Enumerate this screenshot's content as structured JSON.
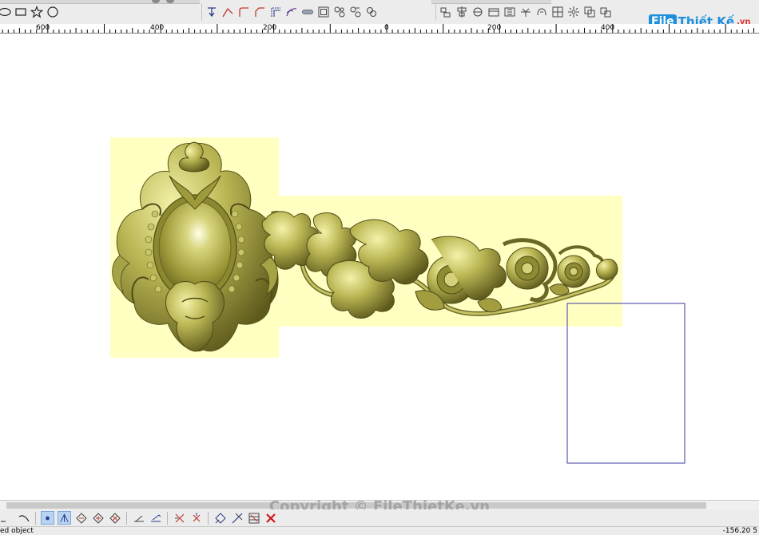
{
  "toolbar_top": {
    "groups": [
      {
        "name": "shapes",
        "icons": [
          "ellipse-icon",
          "rectangle-icon",
          "star-icon",
          "circle-icon"
        ]
      },
      {
        "name": "node-edit",
        "icons": [
          "node-tool-icon",
          "corner-icon",
          "fillet-icon",
          "chamfer-icon",
          "offset-corner-icon",
          "curve-fit-icon",
          "rounded-slot-icon",
          "offset-icon",
          "group-icon",
          "ungroup-icon",
          "merge-icon"
        ]
      },
      {
        "name": "align",
        "icons": [
          "align-left-icon",
          "align-center-icon",
          "align-top-icon",
          "align-middle-icon",
          "distribute-icon",
          "mirror-icon",
          "weld-icon",
          "grid-array-icon",
          "block-copy-icon",
          "rotate-copy-icon",
          "arrange-icon"
        ]
      }
    ]
  },
  "ruler": {
    "labels": [
      "600",
      "400",
      "200",
      "0",
      "200",
      "400"
    ]
  },
  "logo": {
    "file": "File",
    "rest": "Thiết Kế",
    "tld": ".vn"
  },
  "copyright": "Copyright © FileThietKe.vn",
  "toolbar_bottom": {
    "icons": [
      "curve-icon",
      "trace-icon",
      "snap-grid-icon",
      "snap-angle-icon",
      "merge-relief-icon",
      "add-relief-icon",
      "subtract-relief-icon",
      "sculpt-icon",
      "smooth-relief-icon",
      "erase-icon",
      "zero-icon",
      "offset-relief-icon",
      "fade-icon",
      "texture-icon",
      "delete-icon"
    ]
  },
  "status": {
    "left": "ed object",
    "right": "-156.20 5"
  },
  "colors": {
    "relief_background": "#ffffc2",
    "relief_gold": "#a9a64a",
    "boundary_rect": "#3a3aa0"
  }
}
